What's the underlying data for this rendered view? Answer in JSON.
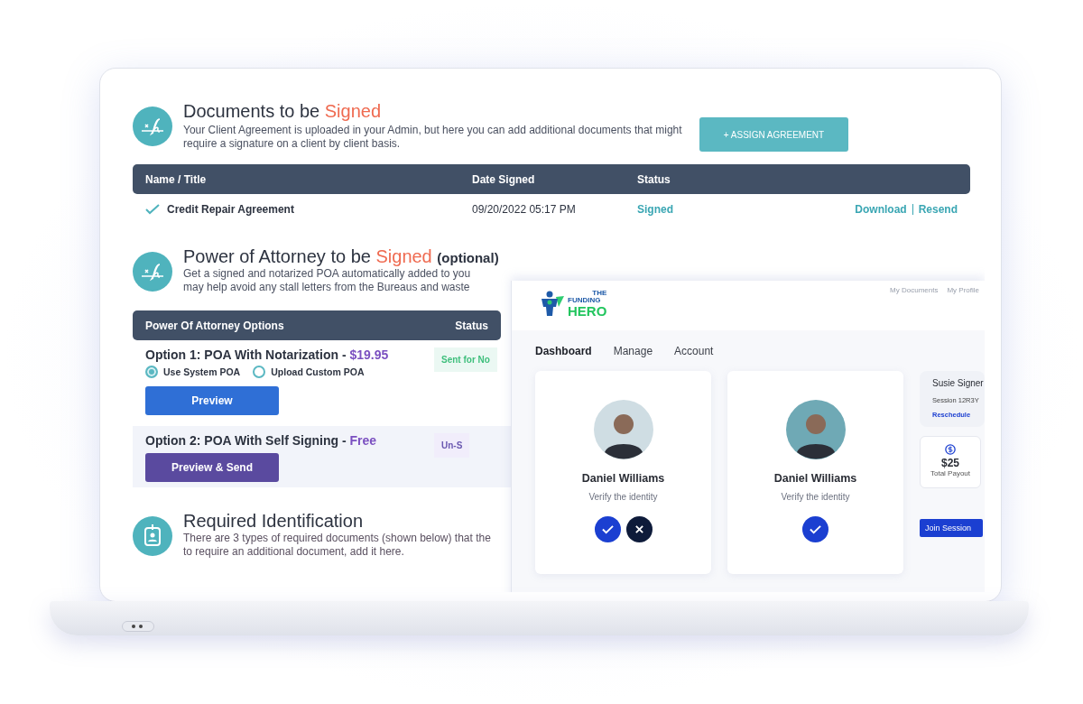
{
  "documents_section": {
    "title": "Documents to be",
    "title_highlight": "Signed",
    "description": "Your Client Agreement is uploaded in your Admin, but here you can add additional documents that might require a signature on a client by client basis.",
    "assign_button": "+ ASSIGN AGREEMENT",
    "table": {
      "columns": [
        "Name / Title",
        "Date Signed",
        "Status"
      ],
      "rows": [
        {
          "name": "Credit Repair Agreement",
          "checked": true,
          "date": "09/20/2022 05:17 PM",
          "status": "Signed",
          "actions": [
            "Download",
            "Resend"
          ]
        }
      ]
    }
  },
  "poa_section": {
    "title": "Power of Attorney to be",
    "title_highlight": "Signed",
    "title_note": "(optional)",
    "description": [
      "Get a signed and notarized POA automatically added to you",
      "may help avoid any stall letters from the Bureaus and waste"
    ],
    "columns": [
      "Power Of Attorney Options",
      "Status"
    ],
    "options": [
      {
        "kind": "notarization",
        "title": "Option 1: POA With Notarization - ",
        "price": "$19.95",
        "status": "Sent for No",
        "radios": [
          {
            "label": "Use System POA",
            "selected": true
          },
          {
            "label": "Upload Custom POA",
            "selected": false
          }
        ],
        "button": "Preview"
      },
      {
        "kind": "self",
        "title": "Option 2: POA With Self Signing - ",
        "price": "Free",
        "status": "Un-S",
        "button": "Preview & Send"
      }
    ]
  },
  "identification_section": {
    "title": "Required Identification",
    "description": [
      "There are 3 types of required documents (shown below) that the",
      "to require an additional document, add it here."
    ]
  },
  "overlay": {
    "logo": {
      "top": "THE",
      "middle": "FUNDING",
      "bottom": "HERO"
    },
    "top_links": [
      "My Documents",
      "My Profile"
    ],
    "tabs": [
      {
        "label": "Dashboard",
        "selected": true
      },
      {
        "label": "Manage",
        "selected": false
      },
      {
        "label": "Account",
        "selected": false
      }
    ],
    "cards": [
      {
        "name": "Daniel Williams",
        "subtitle": "Verify the identity",
        "actions": [
          {
            "kind": "approve"
          },
          {
            "kind": "reject"
          }
        ]
      },
      {
        "name": "Daniel Williams",
        "subtitle": "Verify the identity",
        "actions": [
          {
            "kind": "approve"
          }
        ]
      }
    ],
    "session": {
      "name": "Susie Signer",
      "id": "Session 12R3Y",
      "link": "Reschedule"
    },
    "payout": {
      "amount": "$25",
      "label": "Total Payout"
    },
    "join_button": "Join Session"
  }
}
